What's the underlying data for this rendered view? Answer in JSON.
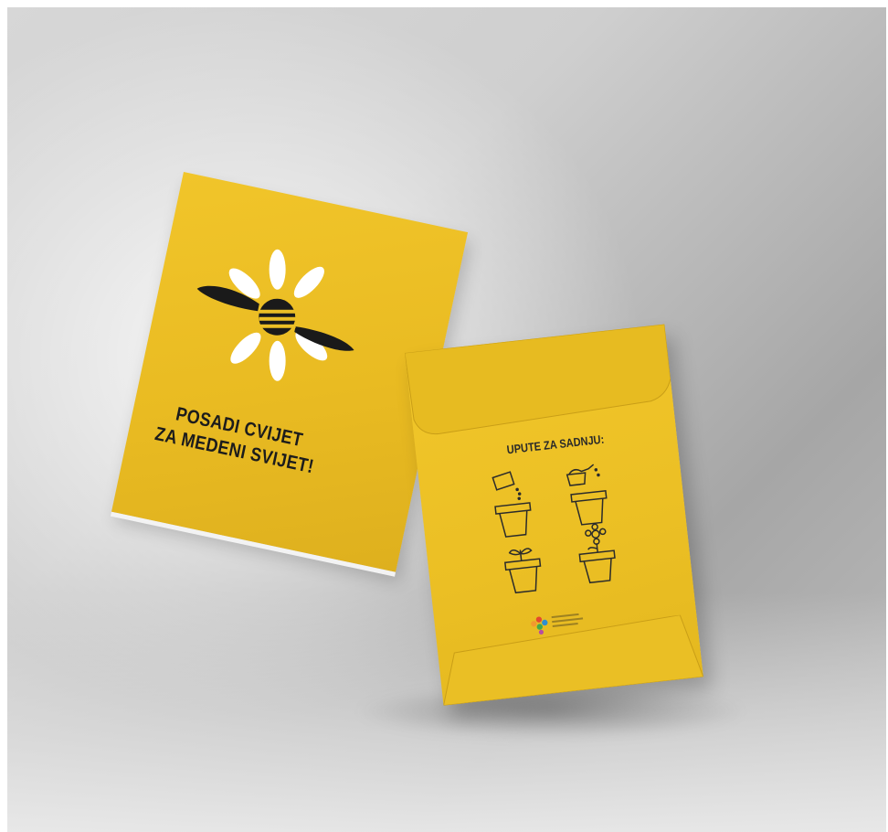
{
  "scene": {
    "background": "#cfcfcf",
    "accent": "#ecbf25"
  },
  "card": {
    "slogan_line1": "POSADI CVIJET",
    "slogan_line2": "ZA MEDENI SVIJET!",
    "icon": "bee-flower-icon"
  },
  "envelope": {
    "instructions_title": "UPUTE ZA SADNJU:",
    "steps": [
      {
        "icon": "seed-packet-pot-icon"
      },
      {
        "icon": "watering-can-pot-icon"
      },
      {
        "icon": "sprout-pot-icon"
      },
      {
        "icon": "flower-pot-icon"
      }
    ],
    "logo_icon": "logo-petals-icon"
  }
}
